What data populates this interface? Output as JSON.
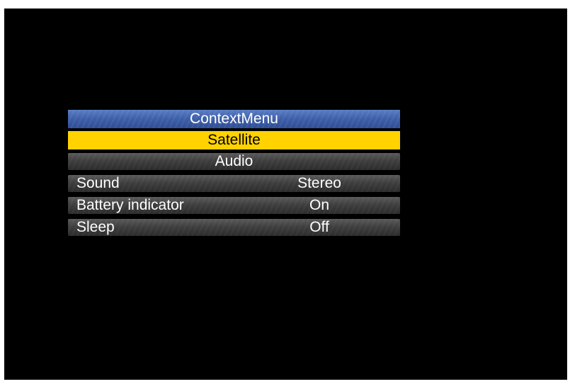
{
  "menu": {
    "title": "ContextMenu",
    "selected_label": "Satellite",
    "section_label": "Audio",
    "items": [
      {
        "label": "Sound",
        "value": "Stereo"
      },
      {
        "label": "Battery indicator",
        "value": "On"
      },
      {
        "label": "Sleep",
        "value": "Off"
      }
    ]
  },
  "colors": {
    "background": "#000000",
    "title_bar": "#3d5ea8",
    "highlight": "#ffd200",
    "row": "#3f3f3f"
  }
}
